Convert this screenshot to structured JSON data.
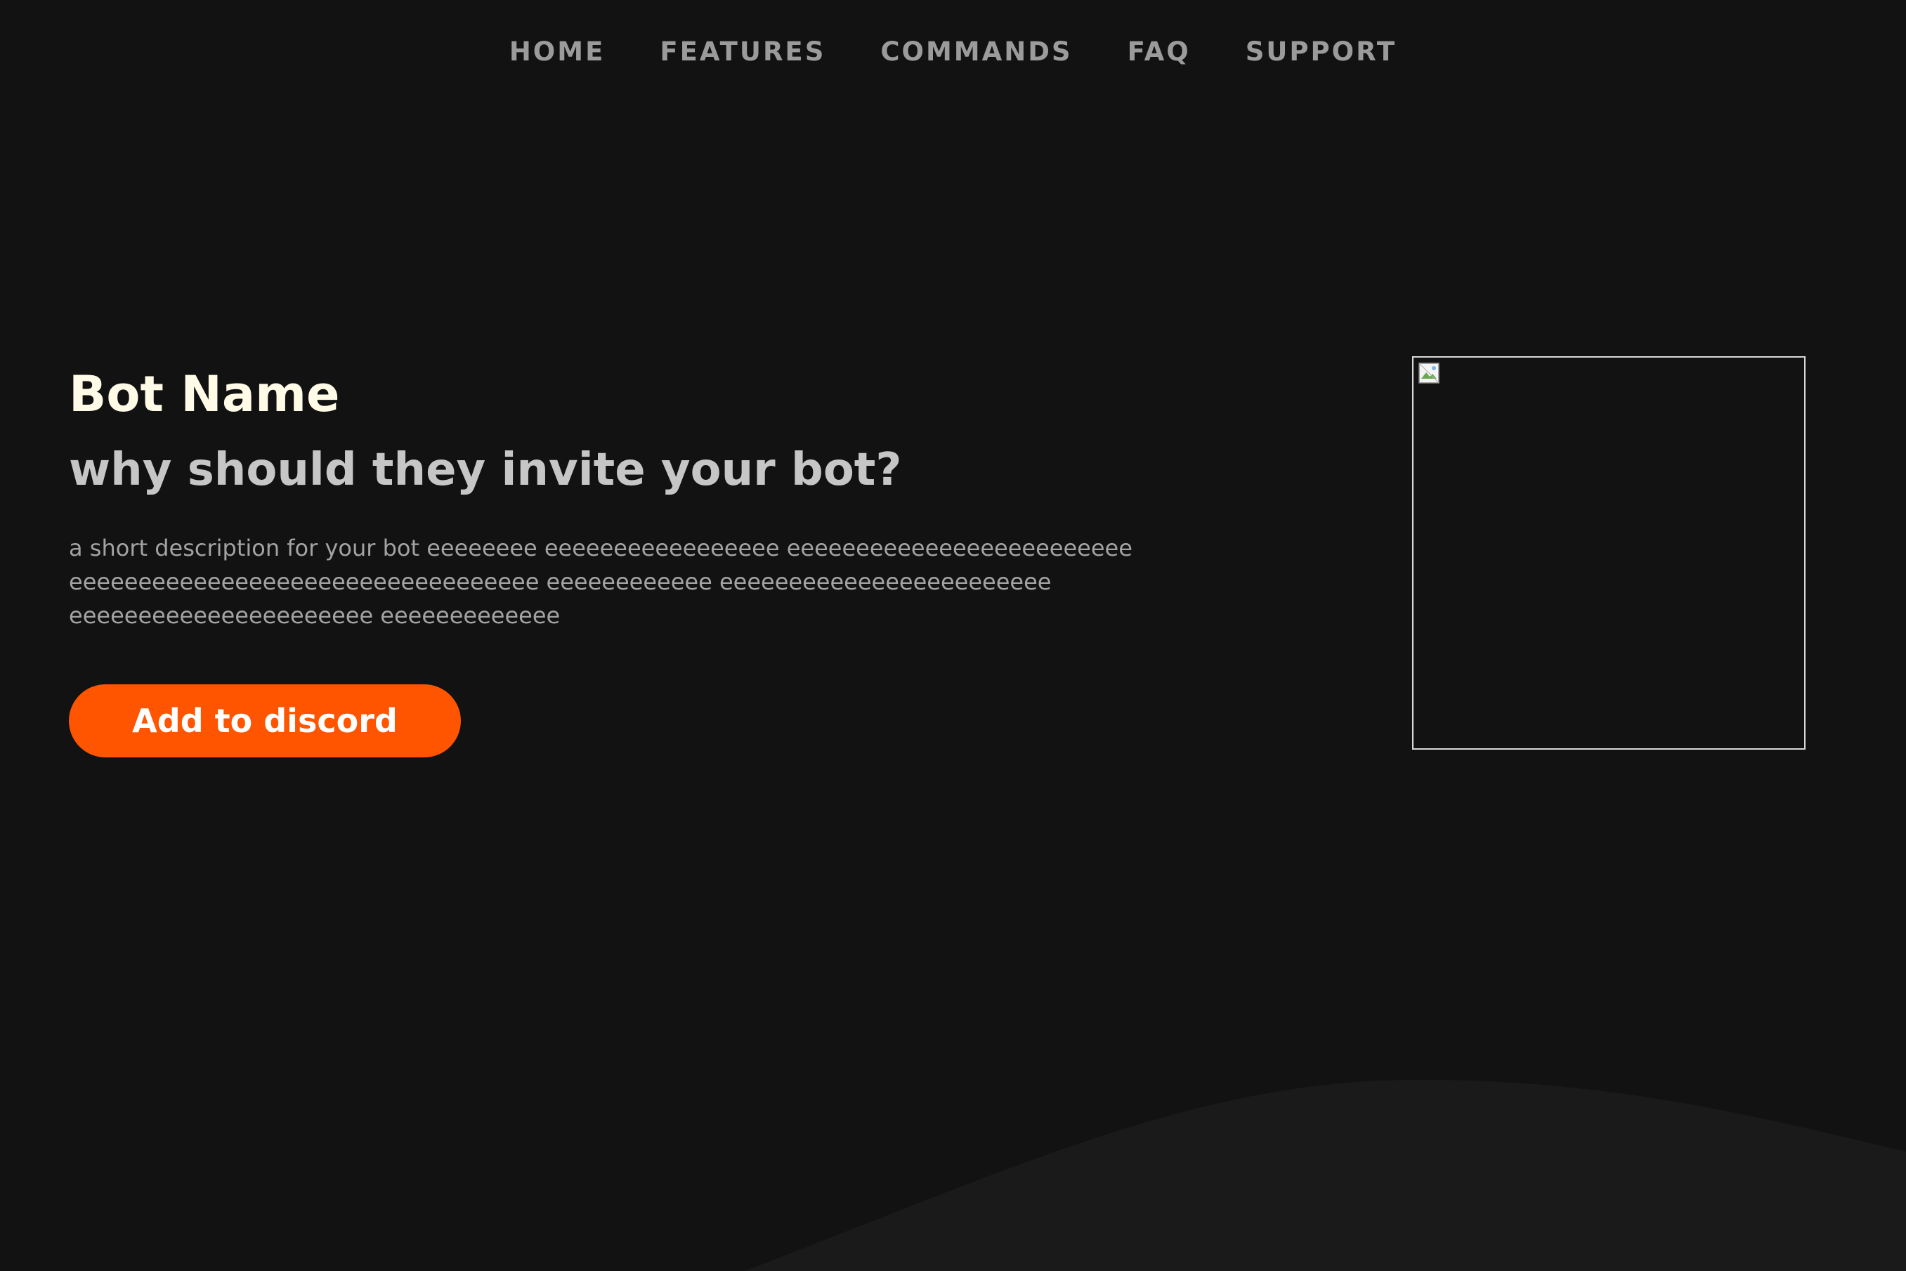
{
  "nav": {
    "items": [
      {
        "label": "HOME"
      },
      {
        "label": "FEATURES"
      },
      {
        "label": "COMMANDS"
      },
      {
        "label": "FAQ"
      },
      {
        "label": "SUPPORT"
      }
    ]
  },
  "hero": {
    "title": "Bot Name",
    "subtitle": "why should they invite your bot?",
    "description": "a short description for your bot eeeeeeee eeeeeeeeeeeeeeeee eeeeeeeeeeeeeeeeeeeeeeeee eeeeeeeeeeeeeeeeeeeeeeeeeeeeeeeeee eeeeeeeeeeee eeeeeeeeeeeeeeeeeeeeeeee eeeeeeeeeeeeeeeeeeeeee eeeeeeeeeeeee",
    "cta_label": "Add to discord"
  },
  "colors": {
    "background": "#121212",
    "accent": "#ff5500",
    "title": "#fffbe7",
    "nav_text": "#9b9b9b",
    "wave": "#1a1a1a"
  },
  "icons": {
    "bot_image": "broken-image-icon"
  }
}
